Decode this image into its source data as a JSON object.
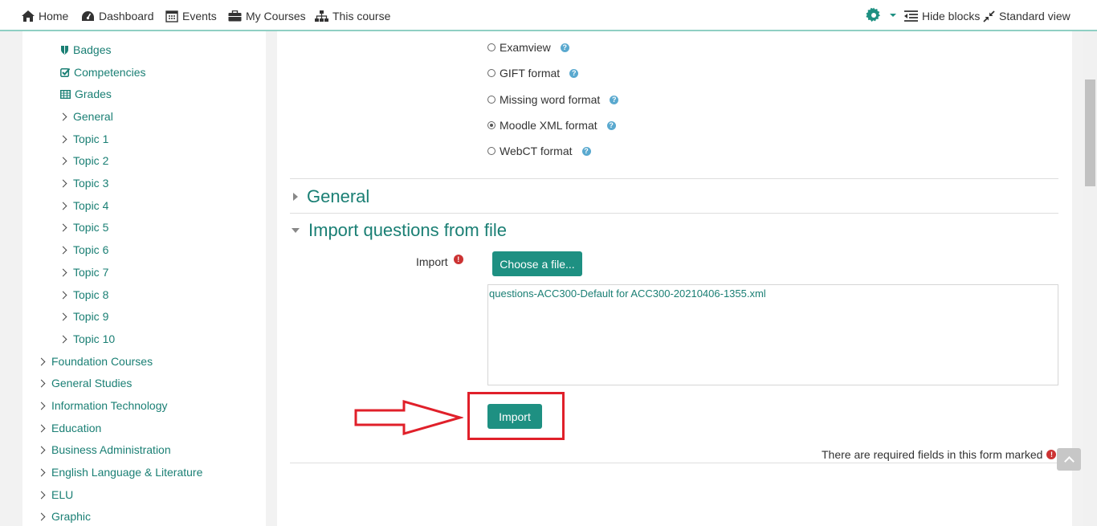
{
  "navbar": {
    "home": "Home",
    "dashboard": "Dashboard",
    "events": "Events",
    "my_courses": "My Courses",
    "this_course": "This course",
    "hide_blocks": "Hide blocks",
    "standard_view": "Standard view"
  },
  "sidebar": {
    "items": [
      {
        "label": "Badges",
        "icon": "shield-icon"
      },
      {
        "label": "Competencies",
        "icon": "checkbox-icon"
      },
      {
        "label": "Grades",
        "icon": "table-icon"
      },
      {
        "label": "General"
      },
      {
        "label": "Topic 1"
      },
      {
        "label": "Topic 2"
      },
      {
        "label": "Topic 3"
      },
      {
        "label": "Topic 4"
      },
      {
        "label": "Topic 5"
      },
      {
        "label": "Topic 6"
      },
      {
        "label": "Topic 7"
      },
      {
        "label": "Topic 8"
      },
      {
        "label": "Topic 9"
      },
      {
        "label": "Topic 10"
      }
    ],
    "categories": [
      "Foundation Courses",
      "General Studies",
      "Information Technology",
      "Education",
      "Business Administration",
      "English Language & Literature",
      "ELU",
      "Graphic"
    ]
  },
  "formats": [
    {
      "label": "Examview",
      "checked": false
    },
    {
      "label": "GIFT format",
      "checked": false
    },
    {
      "label": "Missing word format",
      "checked": false
    },
    {
      "label": "Moodle XML format",
      "checked": true
    },
    {
      "label": "WebCT format",
      "checked": false
    }
  ],
  "sections": {
    "general": "General",
    "import_from_file": "Import questions from file"
  },
  "import_field": {
    "label": "Import",
    "choose_button": "Choose a file...",
    "filename": "questions-ACC300-Default for ACC300-20210406-1355.xml"
  },
  "import_button": "Import",
  "required_note": "There are required fields in this form marked",
  "colors": {
    "accent": "#1e9082",
    "link": "#1a7f74",
    "highlight_red": "#e0202a"
  }
}
